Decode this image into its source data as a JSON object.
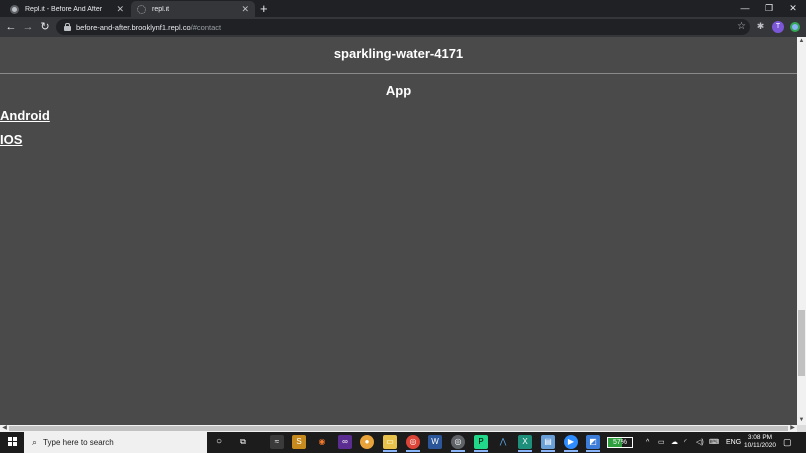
{
  "tabs": [
    {
      "title": "Repl.it - Before And After",
      "active": false
    },
    {
      "title": "repl.it",
      "active": true
    }
  ],
  "window_controls": {
    "minimize": "—",
    "restore": "❐",
    "close": "✕"
  },
  "toolbar": {
    "url_host": "before-and-after.brooklynf1.repl.co",
    "url_path": "/#contact",
    "avatar_letter": "T"
  },
  "page": {
    "site_title": "sparkling-water-4171",
    "section_title": "App",
    "links": [
      {
        "label": "Android"
      },
      {
        "label": "IOS"
      }
    ]
  },
  "taskbar": {
    "search_placeholder": "Type here to search",
    "battery_text": "57%",
    "battery_level": 0.57,
    "language": "ENG",
    "time": "3:08 PM",
    "date": "10/11/2020"
  },
  "colors": {
    "page_background": "#4a4a4a",
    "page_text": "#ffffff",
    "browser_frame": "#202124",
    "toolbar": "#35363a"
  }
}
